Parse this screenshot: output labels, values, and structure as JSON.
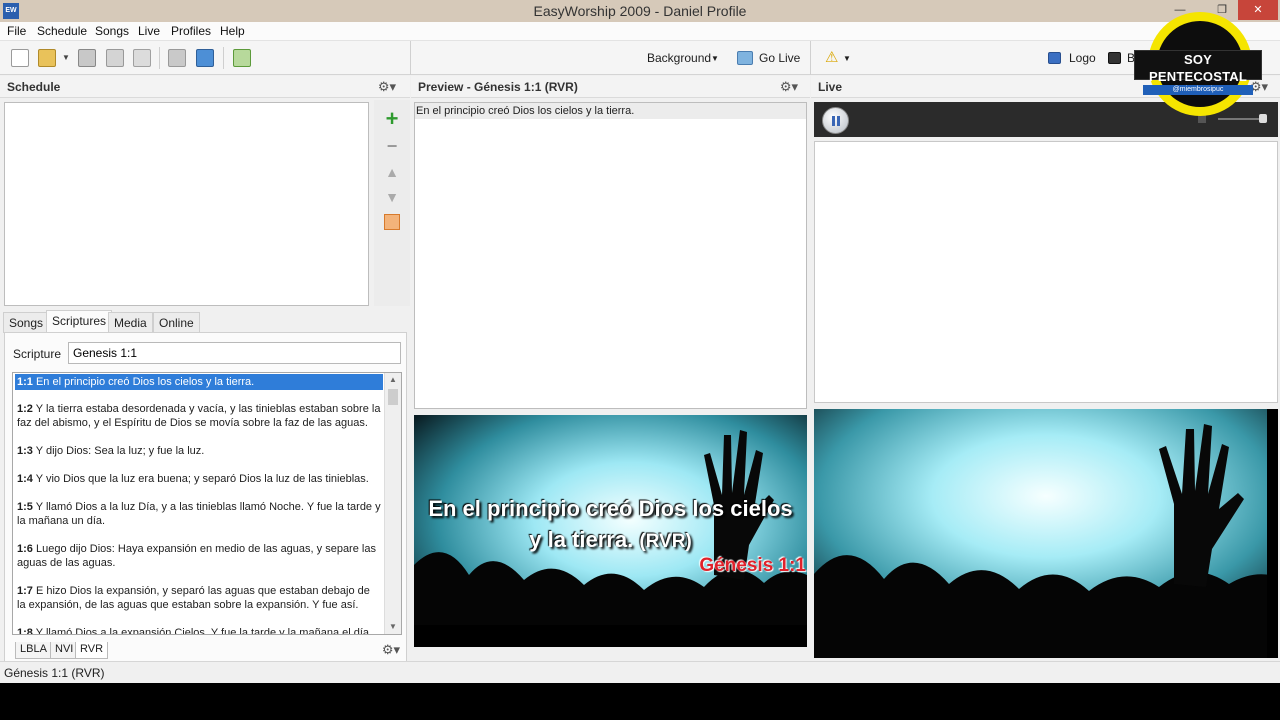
{
  "window": {
    "app_icon": "EW",
    "title": "EasyWorship 2009 - Daniel Profile",
    "controls": {
      "minimize": "—",
      "maximize": "❐",
      "close": "✕"
    }
  },
  "menu": [
    "File",
    "Schedule",
    "Songs",
    "Live",
    "Profiles",
    "Help"
  ],
  "toolbar": {
    "icons": [
      "new-file-icon",
      "open-folder-icon",
      "save-icon",
      "add-icon",
      "edit-icon",
      "print-icon",
      "monitor-icon",
      "add-to-schedule-icon"
    ],
    "background_label": "Background",
    "go_live_label": "Go Live",
    "logo_label": "Logo",
    "black_label": "B"
  },
  "schedule": {
    "title": "Schedule"
  },
  "library": {
    "tabs": [
      "Songs",
      "Scriptures",
      "Media",
      "Online"
    ],
    "active_tab": "Scriptures",
    "scripture_label": "Scripture",
    "scripture_value": "Genesis 1:1",
    "verses": [
      {
        "ref": "1:1",
        "text": "En el principio creó Dios los cielos y la tierra."
      },
      {
        "ref": "1:2",
        "text": "Y la tierra estaba desordenada y vacía, y las tinieblas estaban sobre la faz del abismo, y el Espíritu de Dios se movía sobre la faz de las aguas."
      },
      {
        "ref": "1:3",
        "text": "Y dijo Dios: Sea la luz; y fue la luz."
      },
      {
        "ref": "1:4",
        "text": "Y vio Dios que la luz era buena; y separó Dios la luz de las tinieblas."
      },
      {
        "ref": "1:5",
        "text": "Y llamó Dios a la luz Día, y a las tinieblas llamó Noche. Y fue la tarde y la mañana un día."
      },
      {
        "ref": "1:6",
        "text": "Luego dijo Dios: Haya expansión en medio de las aguas, y separe las aguas de las aguas."
      },
      {
        "ref": "1:7",
        "text": "E hizo Dios la expansión, y separó las aguas que estaban debajo de la expansión, de las aguas que estaban sobre la expansión. Y fue así."
      },
      {
        "ref": "1:8",
        "text": "Y llamó Dios a la expansión Cielos. Y fue la tarde y la mañana el día"
      }
    ],
    "bible_versions": [
      "LBLA",
      "NVI",
      "RVR"
    ],
    "active_version": "RVR"
  },
  "preview": {
    "title": "Preview - Génesis 1:1 (RVR)",
    "text_line": "En el principio creó Dios los cielos y la tierra.",
    "slide_text": "En el principio creó Dios los cielos y la tierra.",
    "slide_tag": "(RVR)",
    "slide_reference": "Génesis 1:1"
  },
  "live": {
    "title": "Live"
  },
  "status": {
    "text": "Génesis 1:1 (RVR)"
  },
  "watermark": {
    "title": "SOY PENTECOSTAL",
    "handle": "@miembrosipuc"
  },
  "colors": {
    "selection": "#2f7dd9",
    "reference_red": "#e0222b",
    "watermark_yellow": "#f5e500"
  }
}
